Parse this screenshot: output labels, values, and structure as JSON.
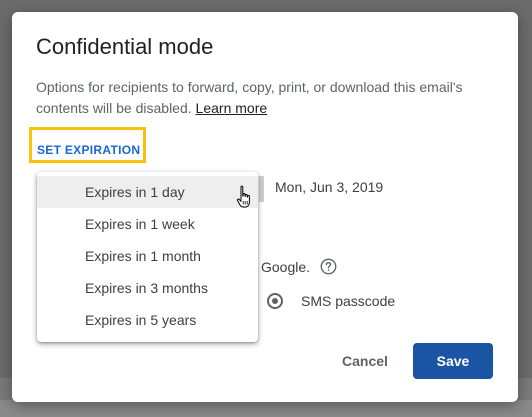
{
  "dialog": {
    "title": "Confidential mode",
    "description": "Options for recipients to forward, copy, print, or download this email's contents will be disabled.",
    "learn_more": "Learn more",
    "set_expiration": "SET EXPIRATION",
    "expiration_date": "Mon, Jun 3, 2019",
    "passcode_text": "Google.",
    "sms_passcode_label": "SMS passcode",
    "cancel_label": "Cancel",
    "save_label": "Save"
  },
  "menu": {
    "items": [
      {
        "label": "Expires in 1 day",
        "hovered": true
      },
      {
        "label": "Expires in 1 week"
      },
      {
        "label": "Expires in 1 month"
      },
      {
        "label": "Expires in 3 months"
      },
      {
        "label": "Expires in 5 years"
      }
    ]
  },
  "colors": {
    "accent": "#1967d2",
    "save_button": "#1a55a3",
    "highlight_box": "#f9c20c"
  },
  "icons": {
    "help": "help-circle-icon",
    "cursor": "hand-pointer-icon"
  }
}
